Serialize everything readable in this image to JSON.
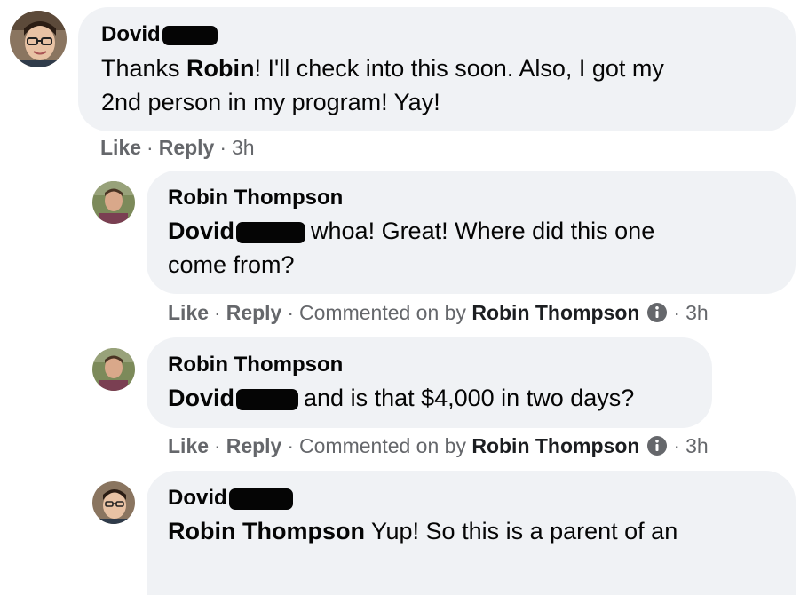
{
  "comments": [
    {
      "author": "Dovid",
      "text_prefix": "Thanks ",
      "tag": "Robin",
      "text_rest_line1": "! I'll check into this soon. Also, I got my",
      "text_line2": "2nd person in my program! Yay!",
      "actions": {
        "like": "Like",
        "reply": "Reply",
        "time": "3h"
      }
    },
    {
      "author": "Robin Thompson",
      "tag": "Dovid",
      "text_line1": "whoa! Great! Where did this one",
      "text_line2": "come from?",
      "actions": {
        "like": "Like",
        "reply": "Reply",
        "commented_on_by": "Commented on by",
        "by_name": "Robin Thompson",
        "time": "3h"
      }
    },
    {
      "author": "Robin Thompson",
      "tag": "Dovid",
      "text_line1": "and is that $4,000 in two days?",
      "actions": {
        "like": "Like",
        "reply": "Reply",
        "commented_on_by": "Commented on by",
        "by_name": "Robin Thompson",
        "time": "3h"
      }
    },
    {
      "author": "Dovid",
      "tag": "Robin Thompson",
      "text_line1": "Yup! So this is a parent of an"
    }
  ],
  "separator": "·",
  "icons": {
    "info": "info-icon",
    "avatar_dovid": "avatar",
    "avatar_robin": "avatar"
  },
  "colors": {
    "bubble": "#f0f2f5",
    "meta": "#65676b",
    "text": "#050505"
  }
}
